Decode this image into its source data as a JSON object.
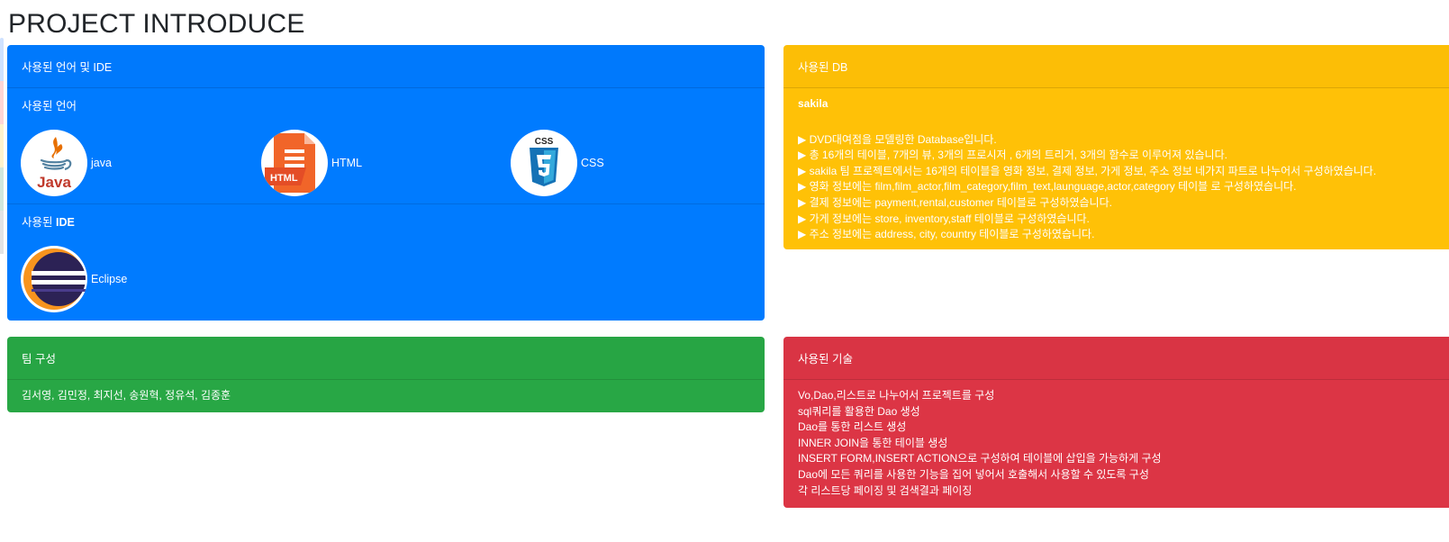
{
  "page": {
    "title": "PROJECT INTRODUCE"
  },
  "lang_card": {
    "header": "사용된 언어 및 IDE",
    "languages_title": "사용된 언어",
    "languages": [
      {
        "label": "java",
        "icon": "java-logo-icon"
      },
      {
        "label": "HTML",
        "icon": "html-logo-icon"
      },
      {
        "label": "CSS",
        "icon": "css-logo-icon"
      }
    ],
    "ide_title_prefix": "사용된 ",
    "ide_title_bold": "IDE",
    "ides": [
      {
        "label": "Eclipse",
        "icon": "eclipse-logo-icon"
      }
    ]
  },
  "db_card": {
    "header": "사용된 DB",
    "db_name": "sakila",
    "lines": [
      "▶ DVD대여점을 모델링한 Database입니다.",
      "▶ 총 16개의 테이블, 7개의 뷰, 3개의 프로시저 , 6개의 트리거, 3개의 함수로 이루어져 있습니다.",
      "▶ sakila 팀 프로젝트에서는 16개의 테이블을 영화 정보, 결제 정보, 가게 정보, 주소 정보 네가지 파트로 나누어서 구성하였습니다.",
      "▶ 영화 정보에는 film,film_actor,film_category,film_text,launguage,actor,category 테이블 로 구성하였습니다.",
      "▶ 결제 정보에는 payment,rental,customer 테이블로 구성하였습니다.",
      "▶ 가게 정보에는 store, inventory,staff 테이블로 구성하였습니다.",
      "▶ 주소 정보에는 address, city, country 테이블로 구성하였습니다."
    ]
  },
  "team_card": {
    "header": "팀 구성",
    "members": "김서영, 김민정, 최지선, 송원혁, 정유석, 김종훈"
  },
  "tech_card": {
    "header": "사용된 기술",
    "lines": [
      "Vo,Dao,리스트로 나누어서 프로젝트를 구성",
      "sql쿼리를 활용한 Dao 생성",
      "Dao를 통한 리스트 생성",
      "INNER JOIN을 통한 테이블 생성",
      "INSERT FORM,INSERT ACTION으로 구성하여 테이블에 삽입을 가능하게 구성",
      "Dao에 모든 쿼리를 사용한 기능을 집어 넣어서 호출해서 사용할 수 있도록 구성",
      "각 리스트당 페이징 및 검색결과 페이징"
    ]
  },
  "colors": {
    "primary": "#007bff",
    "warning": "#ffc107",
    "success": "#28a745",
    "danger": "#dc3545"
  }
}
